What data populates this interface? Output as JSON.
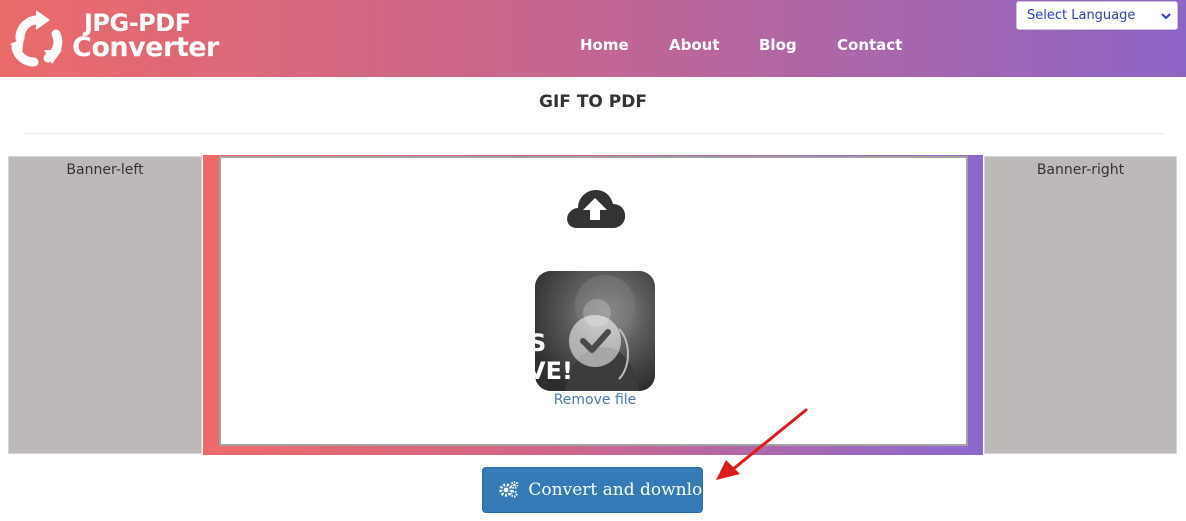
{
  "logo": {
    "line1": "JPG-PDF",
    "line2": "Converter"
  },
  "nav": {
    "items": [
      {
        "label": "Home"
      },
      {
        "label": "About"
      },
      {
        "label": "Blog"
      },
      {
        "label": "Contact"
      }
    ]
  },
  "language": {
    "selected": "Select Language"
  },
  "page": {
    "title": "GIF TO PDF"
  },
  "banners": {
    "left": "Banner-left",
    "right": "Banner-right"
  },
  "upload": {
    "remove_label": "Remove file",
    "thumb_text_1": "S",
    "thumb_text_2": "VE!"
  },
  "actions": {
    "convert_label": "Convert and download"
  },
  "colors": {
    "header_start": "#ea6a6a",
    "header_end": "#8c64c6",
    "button": "#337ab7",
    "annotation_arrow": "#e01b1b"
  }
}
